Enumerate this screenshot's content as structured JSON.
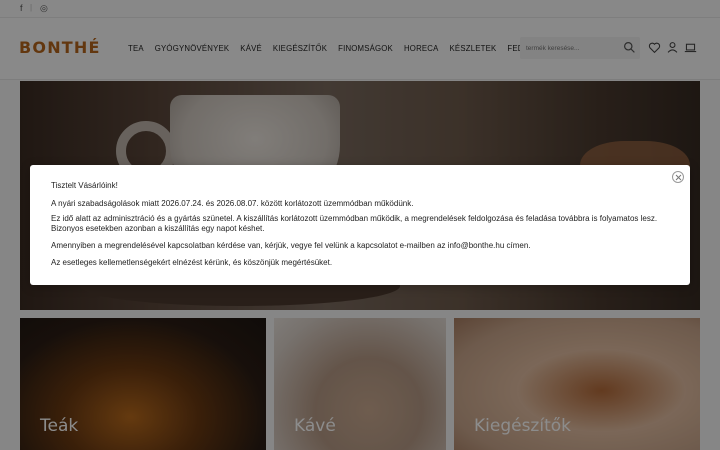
{
  "topbar": {
    "facebook": "f",
    "instagram": "◎"
  },
  "header": {
    "logo": "BONTHÉ",
    "nav": [
      "TEA",
      "GYÓGYNÖVÉNYEK",
      "KÁVÉ",
      "KIEGÉSZÍTŐK",
      "FINOMSÁGOK",
      "HORECA",
      "KÉSZLETEK",
      "FEDEZZE FEL"
    ],
    "search_placeholder": "termék keresése...",
    "icons": [
      "search-icon",
      "heart-icon",
      "user-icon",
      "cart-icon"
    ]
  },
  "categories": [
    {
      "label": "Teák"
    },
    {
      "label": "Kávé"
    },
    {
      "label": "Kiegészítők"
    }
  ],
  "modal": {
    "greeting": "Tisztelt Vásárlóink!",
    "line1": "A nyári szabadságolások miatt 2026.07.24. és 2026.08.07. között korlátozott üzemmódban működünk.",
    "line2": "Ez idő alatt az adminisztráció és a gyártás szünetel. A kiszállítás korlátozott üzemmódban működik, a megrendelések feldolgozása és feladása továbbra is folyamatos lesz.",
    "line3": "Bizonyos esetekben azonban a kiszállítás egy napot késhet.",
    "line4": "Amennyiben a megrendelésével kapcsolatban kérdése van, kérjük, vegye fel velünk a kapcsolatot e-mailben az info@bonthe.hu címen.",
    "line5": "Az esetleges kellemetlenségekért elnézést kérünk, és köszönjük megértésüket."
  },
  "colors": {
    "brand": "#b5651d",
    "overlay": "rgba(0,0,0,0.45)"
  }
}
